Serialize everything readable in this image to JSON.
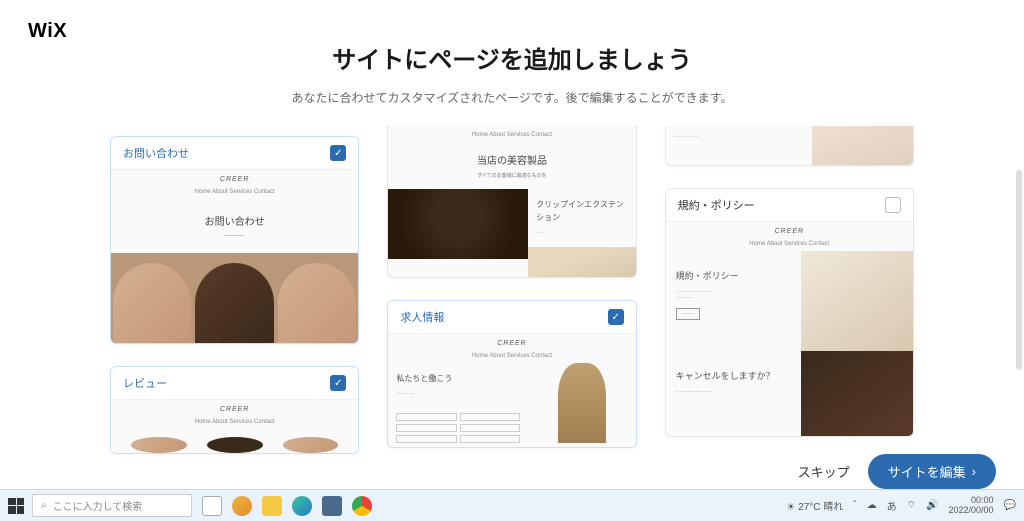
{
  "logo": "WiX",
  "header": {
    "title": "サイトにページを追加しましょう",
    "subtitle": "あなたに合わせてカスタマイズされたページです。後で編集することができます。"
  },
  "brand": "CREER",
  "nav": "Home   About   Services   Contact",
  "cards": {
    "contact": {
      "label": "お問い合わせ",
      "heading": "お問い合わせ",
      "selected": true
    },
    "review": {
      "label": "レビュー",
      "selected": true
    },
    "products": {
      "heading": "当店の美容製品",
      "sub": "すべてのお客様に最適なものを"
    },
    "collection": {
      "heading": "クリップインエクステンション"
    },
    "jobs": {
      "label": "求人情報",
      "heading": "私たちと働こう",
      "selected": true
    },
    "policy": {
      "label": "規約・ポリシー",
      "heading": "規約・ポリシー",
      "cancel": "キャンセルをしますか？",
      "selected": false
    }
  },
  "footer": {
    "skip": "スキップ",
    "edit": "サイトを編集"
  },
  "taskbar": {
    "search": "ここに入力して検索",
    "weather": "27°C 晴れ",
    "time": "00:00",
    "date": "2022/00/00"
  }
}
